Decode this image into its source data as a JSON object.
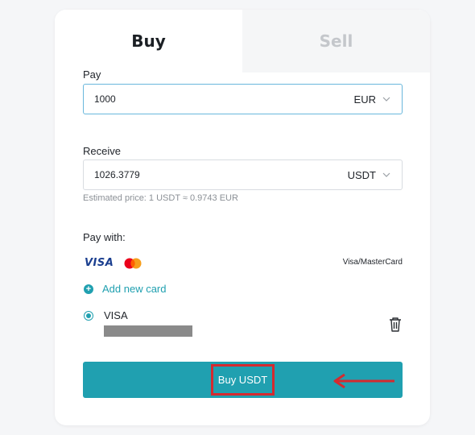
{
  "tabs": {
    "buy": "Buy",
    "sell": "Sell"
  },
  "pay": {
    "label": "Pay",
    "amount": "1000",
    "currency": "EUR"
  },
  "receive": {
    "label": "Receive",
    "amount": "1026.3779",
    "currency": "USDT"
  },
  "estimated_price": "Estimated price: 1 USDT ≈ 0.9743 EUR",
  "payment": {
    "label": "Pay with:",
    "brand_logo": "VISA",
    "method_name": "Visa/MasterCard",
    "add_card": "Add new card",
    "saved_card_brand": "VISA"
  },
  "buy_button": "Buy USDT",
  "colors": {
    "accent": "#20a0b0",
    "highlight": "#d42a2f",
    "visa_blue": "#1a3e8f"
  },
  "icons": [
    "chevron-down-icon",
    "mastercard-icon",
    "plus-circle-icon",
    "radio-selected-icon",
    "trash-icon",
    "arrow-left-icon"
  ]
}
